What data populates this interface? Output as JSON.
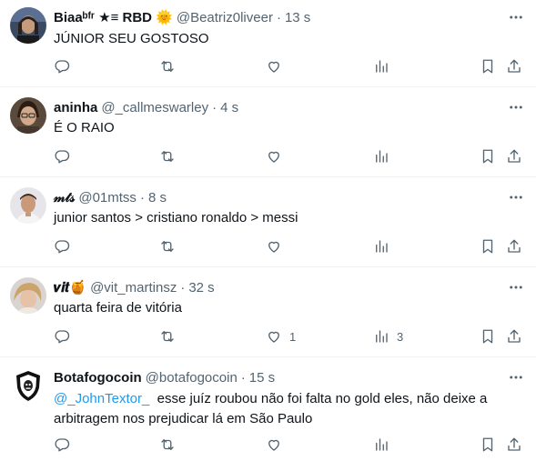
{
  "tweets": [
    {
      "name": "Biaaᵇᶠʳ ★≡ RBD 🌞",
      "handle": "@Beatriz0liveer",
      "time": "13 s",
      "text": "JÚNIOR SEU GOSTOSO",
      "likes": "",
      "views": ""
    },
    {
      "name": "aninha",
      "handle": "@_callmeswarley",
      "time": "4 s",
      "text": "É O RAIO",
      "likes": "",
      "views": ""
    },
    {
      "name": "𝓂𝓉𝓈",
      "handle": "@01mtss",
      "time": "8 s",
      "text": "junior santos > cristiano ronaldo > messi",
      "likes": "",
      "views": ""
    },
    {
      "name": "𝒗𝒊𝒕🍯",
      "handle": "@vit_martinsz",
      "time": "32 s",
      "text": "quarta feira de vitória",
      "likes": "1",
      "views": "3"
    },
    {
      "name": "Botafogocoin",
      "handle": "@botafogocoin",
      "time": "15 s",
      "mention": "@_JohnTextor_",
      "text": "  esse juíz roubou não foi falta no gold eles, não deixe a arbitragem nos prejudicar lá em São Paulo",
      "likes": "",
      "views": ""
    }
  ],
  "colors": {
    "text_primary": "#0f1419",
    "text_secondary": "#536471",
    "mention": "#1d9bf0",
    "divider": "#eff3f4"
  },
  "icons": [
    "more-icon",
    "reply-icon",
    "retweet-icon",
    "like-icon",
    "views-icon",
    "bookmark-icon",
    "share-icon"
  ]
}
